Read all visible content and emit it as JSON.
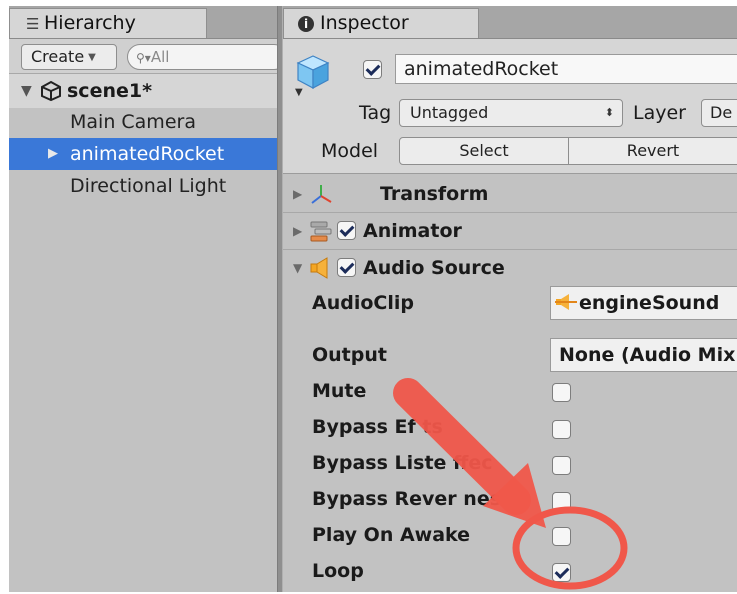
{
  "hierarchy": {
    "tab_label": "Hierarchy",
    "create_label": "Create",
    "search_placeholder": "All",
    "scene_name": "scene1*",
    "items": [
      {
        "label": "Main Camera"
      },
      {
        "label": "animatedRocket",
        "selected": true
      },
      {
        "label": "Directional Light"
      }
    ]
  },
  "inspector": {
    "tab_label": "Inspector",
    "object_name": "animatedRocket",
    "object_active": true,
    "tag_label": "Tag",
    "tag_value": "Untagged",
    "layer_label": "Layer",
    "layer_value": "De",
    "model_label": "Model",
    "select_label": "Select",
    "revert_label": "Revert",
    "components": {
      "transform": {
        "title": "Transform",
        "expanded": false
      },
      "animator": {
        "title": "Animator",
        "enabled": true,
        "expanded": false
      },
      "audio_source": {
        "title": "Audio Source",
        "enabled": true,
        "expanded": true
      }
    },
    "audio_source": {
      "audioclip_label": "AudioClip",
      "audioclip_value": "engineSound",
      "output_label": "Output",
      "output_value": "None (Audio Mix",
      "mute_label": "Mute",
      "mute": false,
      "bypass_effects_label": "Bypass Ef    ts",
      "bypass_effects": false,
      "bypass_listener_label": "Bypass Liste    ffec",
      "bypass_listener": false,
      "bypass_reverb_label": "Bypass Rever     nes",
      "bypass_reverb": false,
      "play_on_awake_label": "Play On Awake",
      "play_on_awake": false,
      "loop_label": "Loop",
      "loop": true
    }
  },
  "colors": {
    "panel_bg": "#c2c2c2",
    "selection": "#3a78d8",
    "annotation_red": "#f0574a"
  },
  "icons": [
    "hierarchy-list-icon",
    "unity-scene-icon",
    "info-icon",
    "cube-icon",
    "transform-axes-icon",
    "animator-icon",
    "speaker-icon",
    "checkmark-icon"
  ]
}
